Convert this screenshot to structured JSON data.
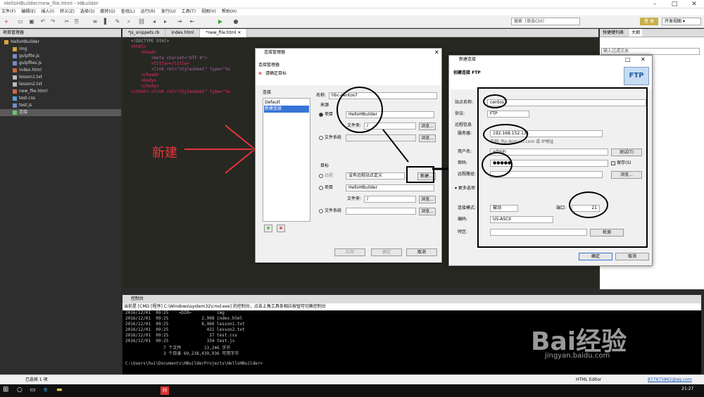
{
  "app": {
    "title": "HelloHBuilder/new_file.html  - HBuilder",
    "menu": [
      "文件(F)",
      "编辑(E)",
      "插入(I)",
      "转义(Z)",
      "选择(S)",
      "跳转(G)",
      "查找(L)",
      "运行(R)",
      "发行(U)",
      "工具(T)",
      "视图(V)",
      "帮助(H)"
    ],
    "search_placeholder": "搜索（双击Ctrl）",
    "login": "登 录",
    "view_mode": "开发视图"
  },
  "project": {
    "header": "项目管理器",
    "items": [
      "HelloHBuilder",
      "img",
      "gulpfile.js",
      "gulpfiles.js",
      "index.html",
      "lesson1.txt",
      "lesson2.txt",
      "new_file.html",
      "test.css",
      "test.js",
      "连接"
    ]
  },
  "tabs": [
    "*js_snippets.rb",
    "index.html",
    "*new_file.html"
  ],
  "editor": {
    "lines": [
      "<!DOCTYPE html>",
      "<html>",
      "    <head>",
      "        <meta charset=\"UTF-8\">",
      "        <title></title>",
      "        <link rel=\"stylesheet\" type=\"te",
      "    </head>",
      "    <body>",
      "    </body>",
      "</html> <link rel=\"stylesheet\" type=\"te"
    ]
  },
  "right_panel": {
    "tabs": [
      "快捷键列表",
      "大纲"
    ],
    "filter_placeholder": "输入过滤文本"
  },
  "conn_dialog": {
    "title": "连接管理器",
    "header": "连接管理器",
    "warning": "请确定目标",
    "list_label": "连接",
    "list_items": [
      "Default",
      "新建连接"
    ],
    "name_label": "名称:",
    "name_value": "hbc-centos7",
    "source_label": "来源",
    "opt_project": "项目",
    "project_value": "HelloHBuilder",
    "folder_label": "文件夹:",
    "folder_value": "/",
    "browse": "浏览...",
    "opt_fs": "文件系统",
    "target_label": "目标",
    "opt_remote": "远程",
    "remote_value": "没有远程站点定义",
    "new_btn": "新建...",
    "opt_project2": "项目",
    "project2_value": "HelloHBuilder",
    "folder2_value": "/",
    "opt_fs2": "文件系统",
    "apply": "应用",
    "ok": "确定",
    "cancel": "取消"
  },
  "ftp_dialog": {
    "title": "新建连接",
    "header": "创建连接 FTP",
    "ftp_logo": "FTP",
    "site_label": "站点名称:",
    "site_value": "centos7",
    "proto_label": "协议:",
    "proto_value": "FTP",
    "remote_info": "远程信息",
    "server_label": "服务器:",
    "server_value": "192.168.152.131",
    "example": "示例: ftp.domain.com 或 IP地址",
    "user_label": "用户名:",
    "user_value": "admin",
    "test_btn": "测试(T)",
    "pass_label": "密码:",
    "pass_value": "●●●●●",
    "save_label": "保存(S)",
    "remote_path_label": "远程路径:",
    "browse": "浏览...",
    "more_label": "更多选项",
    "mode_label": "连接模式:",
    "mode_value": "被动",
    "port_label": "端口:",
    "port_value": "21",
    "enc_label": "编码:",
    "enc_value": "US-ASCII",
    "tz_label": "时区:",
    "detect_btn": "检测",
    "ok": "确定",
    "cancel": "取消"
  },
  "annotation": {
    "text": "新建",
    "color": "#e8343b"
  },
  "console": {
    "header": "控制台",
    "info": "当前是 [CMD [程序] C:\\Windows\\system32\\cmd.exe] 的控制台，点击上角工具条相应按钮可切换控制台",
    "lines": [
      "2016/12/01  09:25    <DIR>          img",
      "2016/12/01  09:25             2,908 index.html",
      "2016/12/01  09:25             8,960 lesson1.txt",
      "2016/12/01  09:25               431 lesson2.txt",
      "2016/12/01  09:25                37 test.css",
      "2016/12/01  09:25               334 test.js",
      "               7 个文件         13,246 字节",
      "               3 个目录 69,238,439,936 可用字节",
      "",
      "C:\\Users\\hui\\Documents\\HBuilderProjects\\HelloHBuilder>"
    ]
  },
  "status": {
    "selected": "已选择 1 项",
    "mode": "HTML Editor",
    "user": "877675862@qq.com",
    "time": "21:27"
  },
  "watermark": {
    "brand": "Bai经验",
    "url": "jingyan.baidu.com"
  }
}
